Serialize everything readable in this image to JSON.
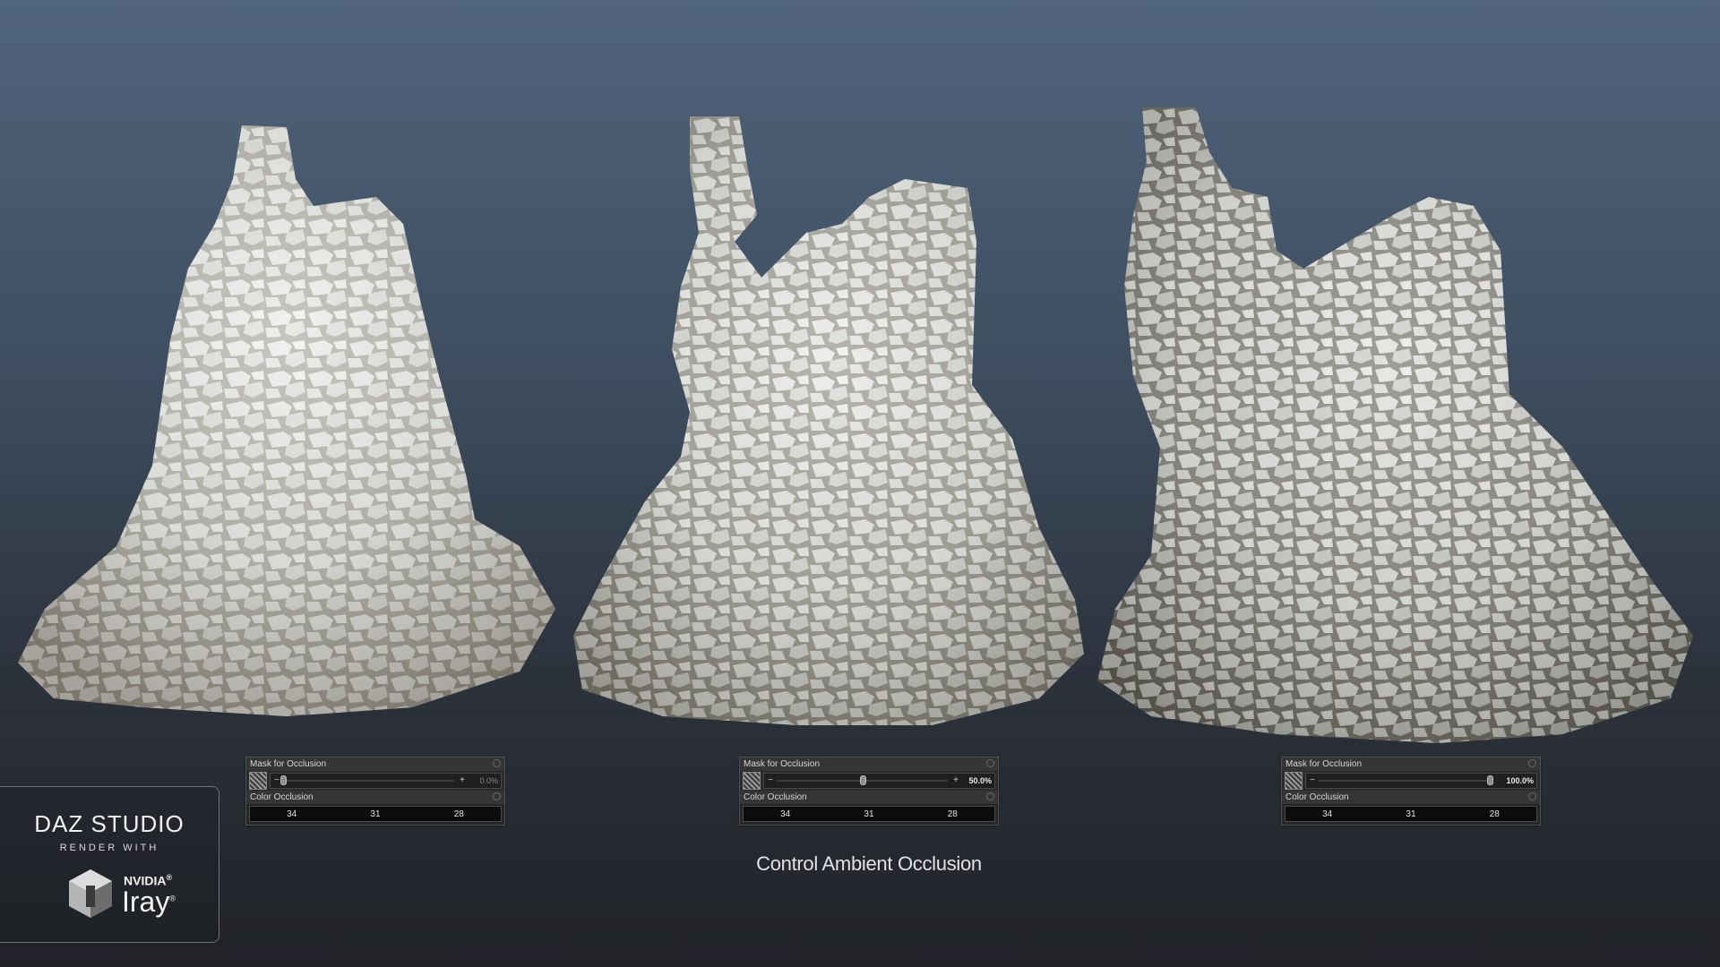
{
  "caption": "Control Ambient Occlusion",
  "logo": {
    "title": "DAZ STUDIO",
    "subtitle": "RENDER WITH",
    "brand_top": "NVIDIA",
    "brand_main": "Iray",
    "registered_mark": "®"
  },
  "panels": [
    {
      "mask_label": "Mask for Occlusion",
      "value_text": "0.0%",
      "value": 0.0,
      "color_label": "Color Occlusion",
      "color_values": [
        "34",
        "31",
        "28"
      ]
    },
    {
      "mask_label": "Mask for Occlusion",
      "value_text": "50.0%",
      "value": 0.5,
      "color_label": "Color Occlusion",
      "color_values": [
        "34",
        "31",
        "28"
      ]
    },
    {
      "mask_label": "Mask for Occlusion",
      "value_text": "100.0%",
      "value": 1.0,
      "color_label": "Color Occlusion",
      "color_values": [
        "34",
        "31",
        "28"
      ]
    }
  ],
  "icons": {
    "map": "texture-map-icon",
    "minus": "minus-icon",
    "plus": "plus-icon",
    "gear": "gear-icon"
  },
  "colors": {
    "snow": "#ecefef",
    "rock": "#6f6a5e",
    "slider_fill": "#4f6a8f"
  }
}
